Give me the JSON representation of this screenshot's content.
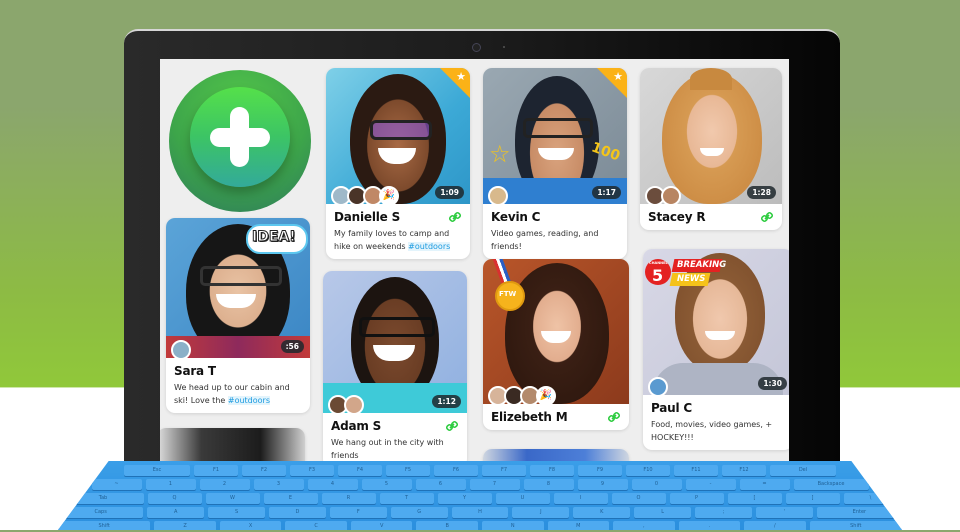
{
  "app": {
    "add_button_label": "Add",
    "accent_color": "#3cc465",
    "hashtag_color": "#1d9be0",
    "link_icon_color": "#2ecc40",
    "featured_color": "#fbb217"
  },
  "cards": [
    {
      "name": "Danielle S",
      "description": "My family loves to camp and hike on weekends ",
      "hashtag": "#outdoors",
      "duration": "1:09",
      "featured": true,
      "has_link": true,
      "overlay": "",
      "avatars": 3,
      "has_party": true
    },
    {
      "name": "Kevin C",
      "description": "Video games, reading, and friends!",
      "hashtag": "",
      "duration": "1:17",
      "featured": true,
      "has_link": false,
      "overlay": "100",
      "avatars": 1,
      "has_party": false
    },
    {
      "name": "Stacey R",
      "description": "",
      "hashtag": "",
      "duration": "1:28",
      "featured": false,
      "has_link": true,
      "overlay": "",
      "avatars": 2,
      "has_party": false
    },
    {
      "name": "Sara T",
      "description": "We head up to our cabin and ski! Love the ",
      "hashtag": "#outdoors",
      "duration": ":56",
      "featured": false,
      "has_link": false,
      "overlay": "IDEA!",
      "avatars": 1,
      "has_party": false
    },
    {
      "name": "Adam S",
      "description": "We hang out in the city with friends",
      "hashtag": "",
      "duration": "1:12",
      "featured": false,
      "has_link": true,
      "overlay": "",
      "avatars": 2,
      "has_party": false
    },
    {
      "name": "Elizebeth M",
      "description": "",
      "hashtag": "",
      "duration": "",
      "featured": false,
      "has_link": true,
      "overlay": "FTW",
      "avatars": 3,
      "has_party": true
    },
    {
      "name": "Paul C",
      "description": "Food, movies, video games, + HOCKEY!!!",
      "hashtag": "",
      "duration": "1:30",
      "featured": false,
      "has_link": false,
      "overlay": "BREAKING NEWS",
      "avatars": 1,
      "has_party": false
    }
  ],
  "stickers": {
    "idea": "IDEA!",
    "ftw": "FTW",
    "breaking": "BREAKING",
    "news": "NEWS",
    "channel": "CHANNEL",
    "channel_num": "5",
    "hundred": "100"
  },
  "keyboard": {
    "rows": [
      [
        "Esc",
        "F1",
        "F2",
        "F3",
        "F4",
        "F5",
        "F6",
        "F7",
        "F8",
        "F9",
        "F10",
        "F11",
        "F12",
        "Del"
      ],
      [
        "~",
        "1",
        "2",
        "3",
        "4",
        "5",
        "6",
        "7",
        "8",
        "9",
        "0",
        "-",
        "=",
        "Backspace"
      ],
      [
        "Tab",
        "Q",
        "W",
        "E",
        "R",
        "T",
        "Y",
        "U",
        "I",
        "O",
        "P",
        "[",
        "]",
        "\\"
      ],
      [
        "Caps",
        "A",
        "S",
        "D",
        "F",
        "G",
        "H",
        "J",
        "K",
        "L",
        ";",
        "'",
        "Enter"
      ],
      [
        "Shift",
        "Z",
        "X",
        "C",
        "V",
        "B",
        "N",
        "M",
        ",",
        ".",
        "/",
        "Shift"
      ]
    ]
  }
}
